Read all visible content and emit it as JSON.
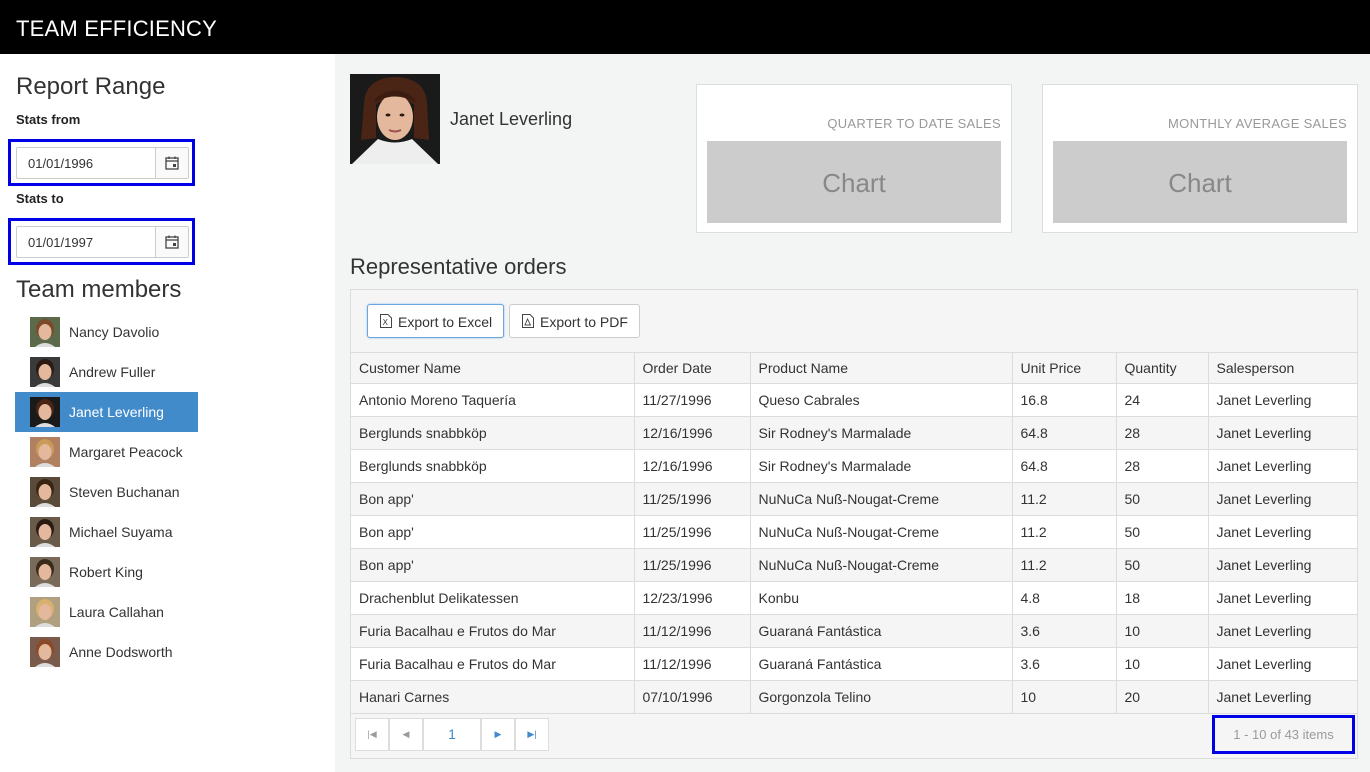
{
  "app": {
    "title": "TEAM EFFICIENCY"
  },
  "report_range": {
    "heading": "Report Range",
    "from_label": "Stats from",
    "from_value": "01/01/1996",
    "to_label": "Stats to",
    "to_value": "01/01/1997"
  },
  "team": {
    "heading": "Team members",
    "members": [
      {
        "name": "Nancy Davolio",
        "selected": false
      },
      {
        "name": "Andrew Fuller",
        "selected": false
      },
      {
        "name": "Janet Leverling",
        "selected": true
      },
      {
        "name": "Margaret Peacock",
        "selected": false
      },
      {
        "name": "Steven Buchanan",
        "selected": false
      },
      {
        "name": "Michael Suyama",
        "selected": false
      },
      {
        "name": "Robert King",
        "selected": false
      },
      {
        "name": "Laura Callahan",
        "selected": false
      },
      {
        "name": "Anne Dodsworth",
        "selected": false
      }
    ]
  },
  "profile": {
    "name": "Janet Leverling"
  },
  "cards": [
    {
      "title": "QUARTER TO DATE SALES",
      "placeholder": "Chart"
    },
    {
      "title": "MONTHLY AVERAGE SALES",
      "placeholder": "Chart"
    }
  ],
  "orders": {
    "heading": "Representative orders",
    "toolbar": {
      "excel_label": "Export to Excel",
      "pdf_label": "Export to PDF"
    },
    "columns": [
      "Customer Name",
      "Order Date",
      "Product Name",
      "Unit Price",
      "Quantity",
      "Salesperson"
    ],
    "rows": [
      [
        "Antonio Moreno Taquería",
        "11/27/1996",
        "Queso Cabrales",
        "16.8",
        "24",
        "Janet Leverling"
      ],
      [
        "Berglunds snabbköp",
        "12/16/1996",
        "Sir Rodney's Marmalade",
        "64.8",
        "28",
        "Janet Leverling"
      ],
      [
        "Berglunds snabbköp",
        "12/16/1996",
        "Sir Rodney's Marmalade",
        "64.8",
        "28",
        "Janet Leverling"
      ],
      [
        "Bon app'",
        "11/25/1996",
        "NuNuCa Nuß-Nougat-Creme",
        "11.2",
        "50",
        "Janet Leverling"
      ],
      [
        "Bon app'",
        "11/25/1996",
        "NuNuCa Nuß-Nougat-Creme",
        "11.2",
        "50",
        "Janet Leverling"
      ],
      [
        "Bon app'",
        "11/25/1996",
        "NuNuCa Nuß-Nougat-Creme",
        "11.2",
        "50",
        "Janet Leverling"
      ],
      [
        "Drachenblut Delikatessen",
        "12/23/1996",
        "Konbu",
        "4.8",
        "18",
        "Janet Leverling"
      ],
      [
        "Furia Bacalhau e Frutos do Mar",
        "11/12/1996",
        "Guaraná Fantástica",
        "3.6",
        "10",
        "Janet Leverling"
      ],
      [
        "Furia Bacalhau e Frutos do Mar",
        "11/12/1996",
        "Guaraná Fantástica",
        "3.6",
        "10",
        "Janet Leverling"
      ],
      [
        "Hanari Carnes",
        "07/10/1996",
        "Gorgonzola Telino",
        "10",
        "20",
        "Janet Leverling"
      ]
    ],
    "pager": {
      "current_page": "1",
      "info": "1 - 10 of 43 items"
    }
  },
  "colors": {
    "selected": "#428bca",
    "highlight": "#0000e6",
    "header_bg": "#000000"
  },
  "icons": [
    "calendar-icon",
    "excel-file-icon",
    "pdf-file-icon",
    "first-page-icon",
    "prev-page-icon",
    "next-page-icon",
    "last-page-icon"
  ]
}
